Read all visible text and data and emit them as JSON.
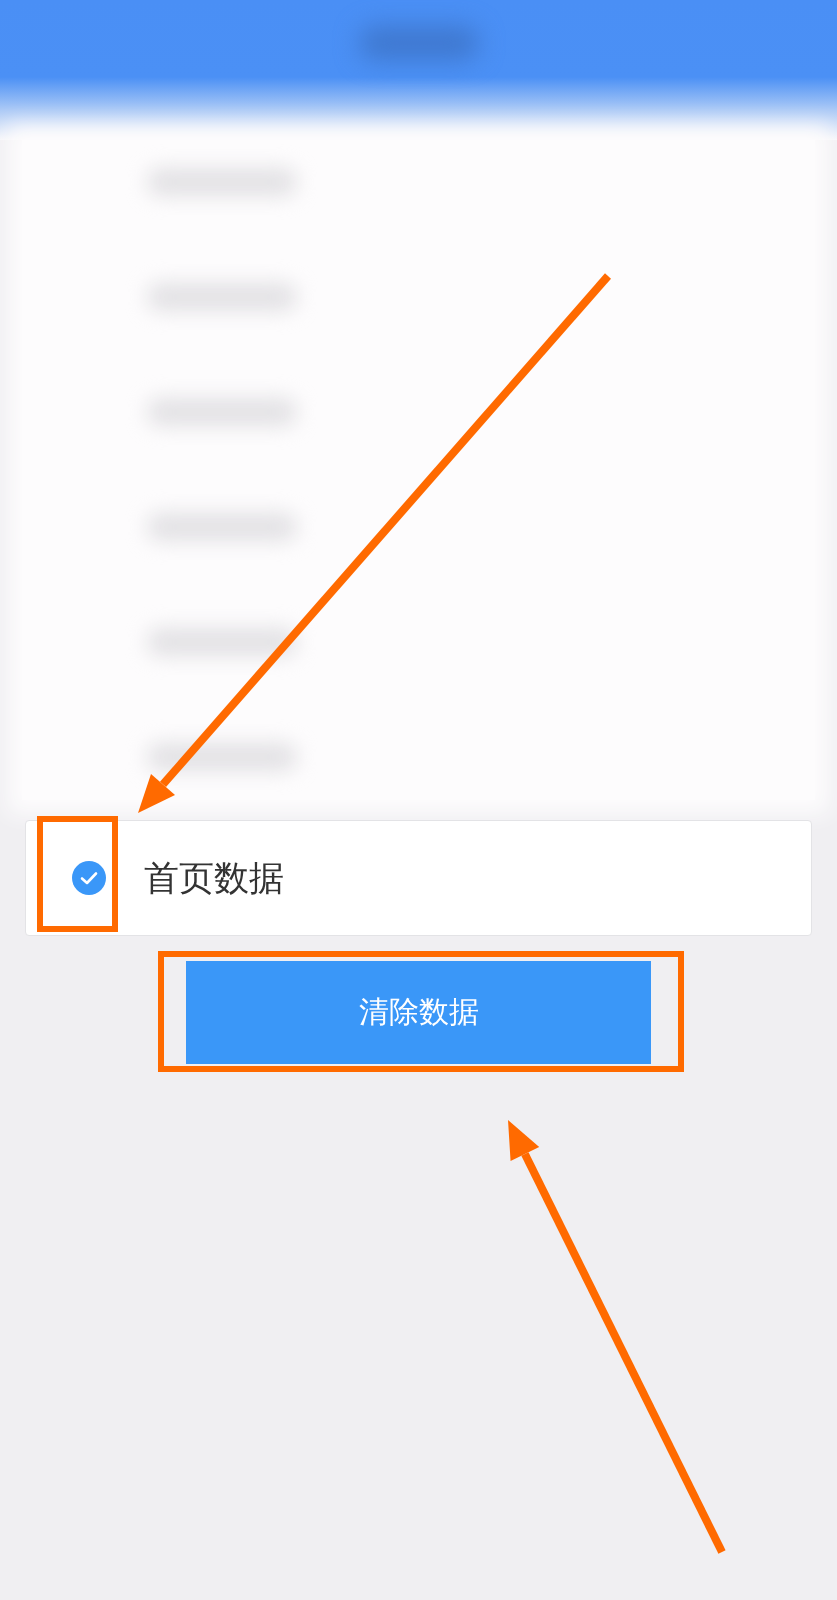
{
  "options": [
    {
      "label": "首页数据",
      "checked": true
    }
  ],
  "clear_button": {
    "label": "清除数据"
  }
}
